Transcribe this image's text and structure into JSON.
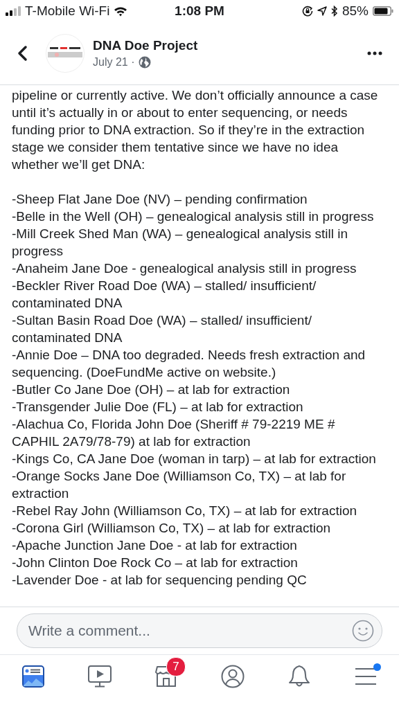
{
  "status_bar": {
    "carrier": "T-Mobile Wi-Fi",
    "time": "1:08 PM",
    "battery": "85%"
  },
  "header": {
    "page_name": "DNA Doe Project",
    "date": "July 21 ·"
  },
  "post": {
    "intro": "pipeline or currently active. We don’t officially announce a case until it’s actually in or about to enter sequencing, or needs funding prior to DNA extraction. So if they’re in the extraction stage we consider them tentative since we have no idea whether we’ll get DNA:",
    "items": [
      "-Sheep Flat Jane Doe (NV) – pending confirmation",
      "-Belle in the Well (OH) – genealogical analysis still in progress",
      "-Mill Creek Shed Man (WA) – genealogical analysis still in progress",
      "-Anaheim Jane Doe -  genealogical analysis still in progress",
      "-Beckler River Road Doe (WA) – stalled/ insufficient/ contaminated DNA",
      "-Sultan Basin Road Doe (WA) – stalled/ insufficient/ contaminated DNA",
      "-Annie Doe – DNA too degraded. Needs fresh extraction and sequencing. (DoeFundMe active on website.)",
      "-Butler Co Jane Doe (OH) – at lab for extraction",
      "-Transgender Julie Doe (FL) – at lab for extraction",
      "-Alachua Co, Florida John Doe (Sheriff # 79-2219 ME # CAPHIL 2A79/78-79) at lab for extraction",
      "-Kings Co, CA Jane Doe (woman in tarp) – at lab for extraction",
      "-Orange Socks Jane Doe (Williamson Co, TX) – at lab for extraction",
      "-Rebel Ray John (Williamson Co, TX) – at lab for extraction",
      "-Corona Girl (Williamson Co, TX) – at lab for extraction",
      "-Apache Junction Jane Doe - at lab for extraction",
      "-John Clinton Doe  Rock Co – at lab for extraction",
      "-Lavender Doe - at lab for sequencing pending QC"
    ]
  },
  "comment_field": {
    "placeholder": "Write a comment..."
  },
  "tab_bar": [
    {
      "kind": "news",
      "selected": true
    },
    {
      "kind": "video",
      "selected": false
    },
    {
      "kind": "marketplace",
      "selected": false,
      "badge": "7"
    },
    {
      "kind": "profile",
      "selected": false
    },
    {
      "kind": "notifications",
      "selected": false
    },
    {
      "kind": "menu",
      "selected": false,
      "unread": true
    }
  ]
}
